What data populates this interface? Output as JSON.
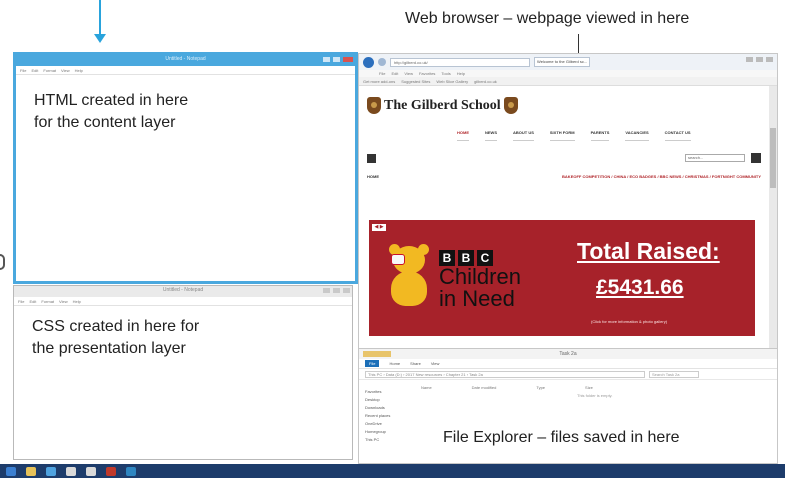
{
  "captions": {
    "browser": "Web browser – webpage viewed in here",
    "html_editor": [
      "HTML created in here",
      "for the content layer"
    ],
    "css_editor": [
      "CSS created in here for",
      "the presentation layer"
    ],
    "explorer": "File Explorer – files saved in here"
  },
  "notepad_html": {
    "title": "Untitled - Notepad",
    "menu": [
      "File",
      "Edit",
      "Format",
      "View",
      "Help"
    ]
  },
  "notepad_css": {
    "title": "Untitled - Notepad",
    "menu": [
      "File",
      "Edit",
      "Format",
      "View",
      "Help"
    ]
  },
  "browser": {
    "address": "http://gilberd.co.uk/",
    "tab": "Welcome to the Gilberd sc...",
    "menus": [
      "File",
      "Edit",
      "View",
      "Favorites",
      "Tools",
      "Help"
    ],
    "favorites": [
      "Get more add-ons",
      "Suggested Sites",
      "Web Slice Gallery",
      "gilberd.co.uk"
    ]
  },
  "website": {
    "school_name": "The Gilberd School",
    "nav": [
      "HOME",
      "NEWS",
      "ABOUT US",
      "SIXTH FORM",
      "PARENTS",
      "VACANCIES",
      "CONTACT US"
    ],
    "search_placeholder": "search...",
    "home_link": "HOME",
    "news_link": "BAKEOFF COMPETITION / CHINA / ECO BADGES / BBC NEWS / CHRISTMAS / FORTNIGHT COMMUNITY"
  },
  "banner": {
    "badge": "◀ ▶",
    "bbc_letters": [
      "B",
      "B",
      "C"
    ],
    "line1": "Children",
    "line2": "in Need",
    "total_label": "Total Raised:",
    "total_value": "£5431.66",
    "note": "(Click for more information & photo gallery)"
  },
  "explorer": {
    "title": "Task 2a",
    "ribbon": [
      "File",
      "Home",
      "Share",
      "View"
    ],
    "path": "This PC › Data (D:) › 2017 New resources › Chapter 21 › Task 2a",
    "search": "Search Task 2a",
    "nav": [
      "Favorites",
      "Desktop",
      "Downloads",
      "Recent places",
      "",
      "OneDrive",
      "",
      "Homegroup",
      "",
      "This PC"
    ],
    "columns": [
      "Name",
      "Date modified",
      "Type",
      "Size"
    ],
    "empty": "This folder is empty."
  },
  "colors": {
    "accent_blue": "#29a3dc",
    "window_blue": "#4aa8de",
    "banner_red": "#a7222a",
    "pudsey_yellow": "#f2b922",
    "taskbar": "#1d3c6b"
  }
}
